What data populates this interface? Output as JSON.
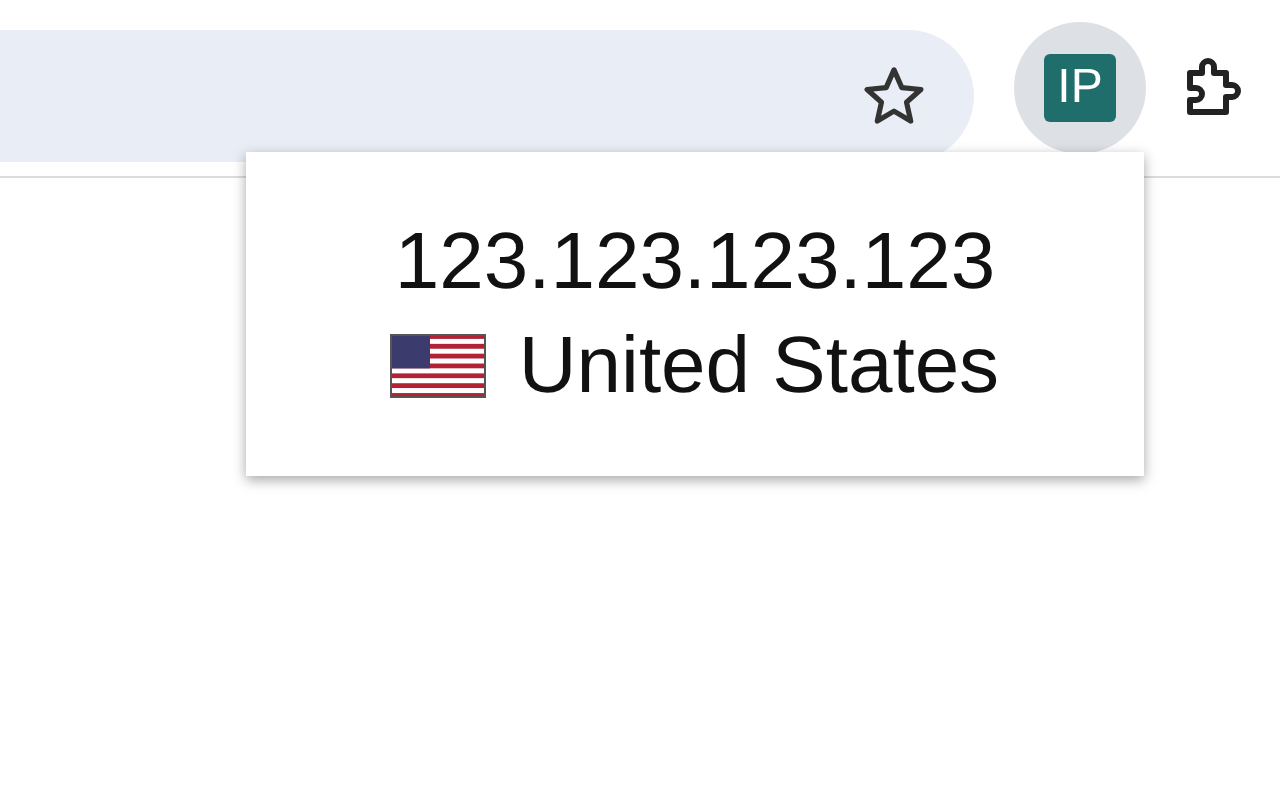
{
  "toolbar": {
    "extension_button": {
      "label": "IP",
      "selected": true
    }
  },
  "popup": {
    "ip": "123.123.123.123",
    "country": "United States"
  }
}
